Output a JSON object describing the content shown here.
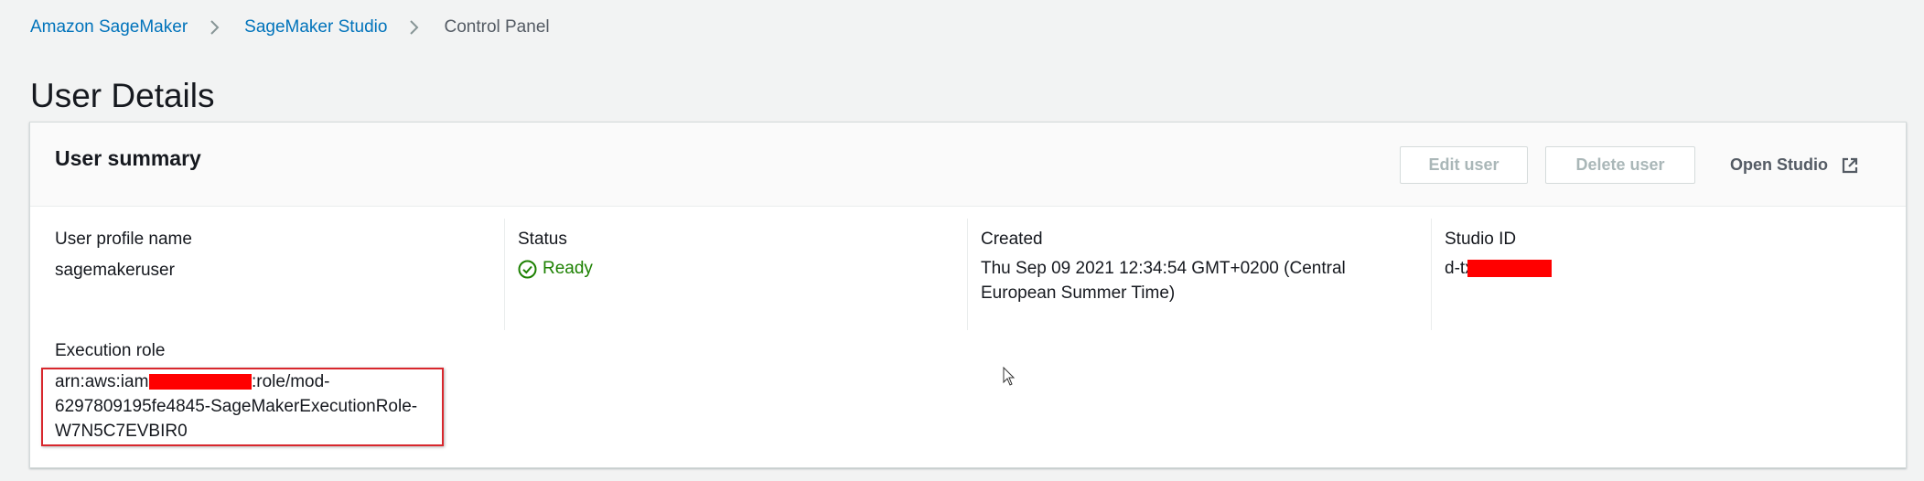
{
  "breadcrumb": {
    "items": [
      {
        "label": "Amazon SageMaker"
      },
      {
        "label": "SageMaker Studio"
      },
      {
        "label": "Control Panel"
      }
    ]
  },
  "page": {
    "title": "User Details"
  },
  "summary": {
    "title": "User summary",
    "buttons": {
      "edit_label": "Edit user",
      "delete_label": "Delete user",
      "open_label": "Open Studio"
    },
    "fields": {
      "profile_name_label": "User profile name",
      "profile_name_value": "sagemakeruser",
      "status_label": "Status",
      "status_value": "Ready",
      "created_label": "Created",
      "created_value_line1": "Thu Sep 09 2021 12:34:54 GMT+0200 (Central",
      "created_value_line2": "European Summer Time)",
      "studio_id_label": "Studio ID",
      "studio_id_prefix": "d-tx",
      "execution_role_label": "Execution role",
      "execution_role_line1_prefix": "arn:aws:iam::",
      "execution_role_line1_suffix": ":role/mod-",
      "execution_role_line2": "6297809195fe4845-SageMakerExecutionRole-",
      "execution_role_line3": "W7N5C7EVBIR0"
    }
  },
  "colors": {
    "link": "#0073bb",
    "status_ok": "#1d8102",
    "redaction": "#ff0000",
    "highlight": "#d8272d"
  },
  "icons": {
    "breadcrumb_separator": "chevron-right-icon",
    "status": "check-circle-icon",
    "open_studio": "external-link-icon"
  }
}
